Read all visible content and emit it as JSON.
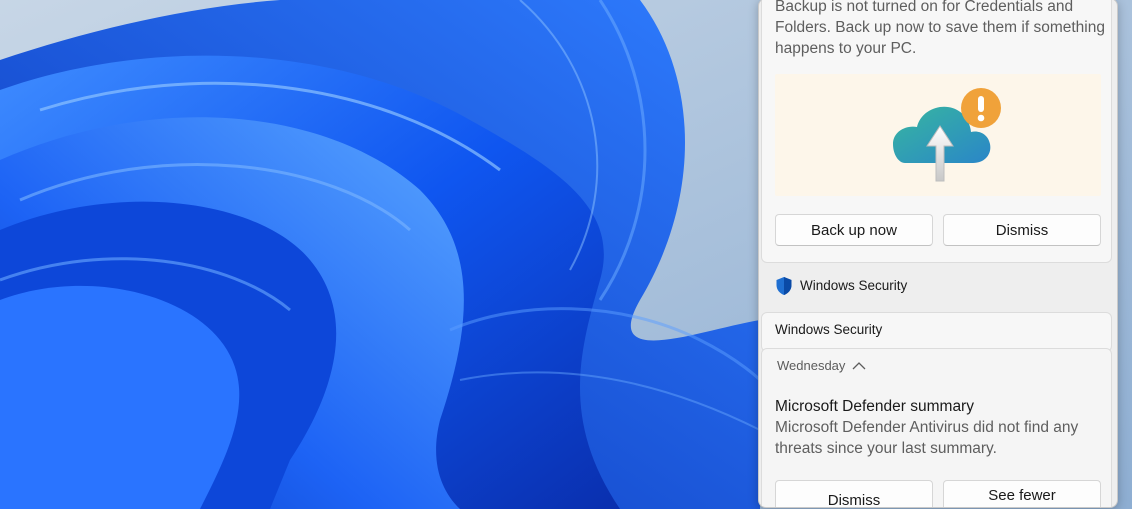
{
  "backup_notification": {
    "body": "Backup is not turned on for Credentials and Folders. Back up now to save them if something happens to your PC.",
    "icon": "cloud-upload-warning-icon",
    "primary_button": "Back up now",
    "secondary_button": "Dismiss"
  },
  "app_group": {
    "icon": "windows-security-shield-icon",
    "name": "Windows Security"
  },
  "stacked_notification": {
    "title": "Windows Security"
  },
  "defender_notification": {
    "day_label": "Wednesday",
    "title": "Microsoft Defender summary",
    "body": "Microsoft Defender Antivirus did not find any threats since your last summary.",
    "dismiss_button": "Dismiss",
    "see_fewer_button": "See fewer"
  },
  "colors": {
    "accent_orange": "#f0a23a",
    "cloud_teal": "#2aa6b7",
    "wallpaper_blue": "#1a55e8"
  }
}
